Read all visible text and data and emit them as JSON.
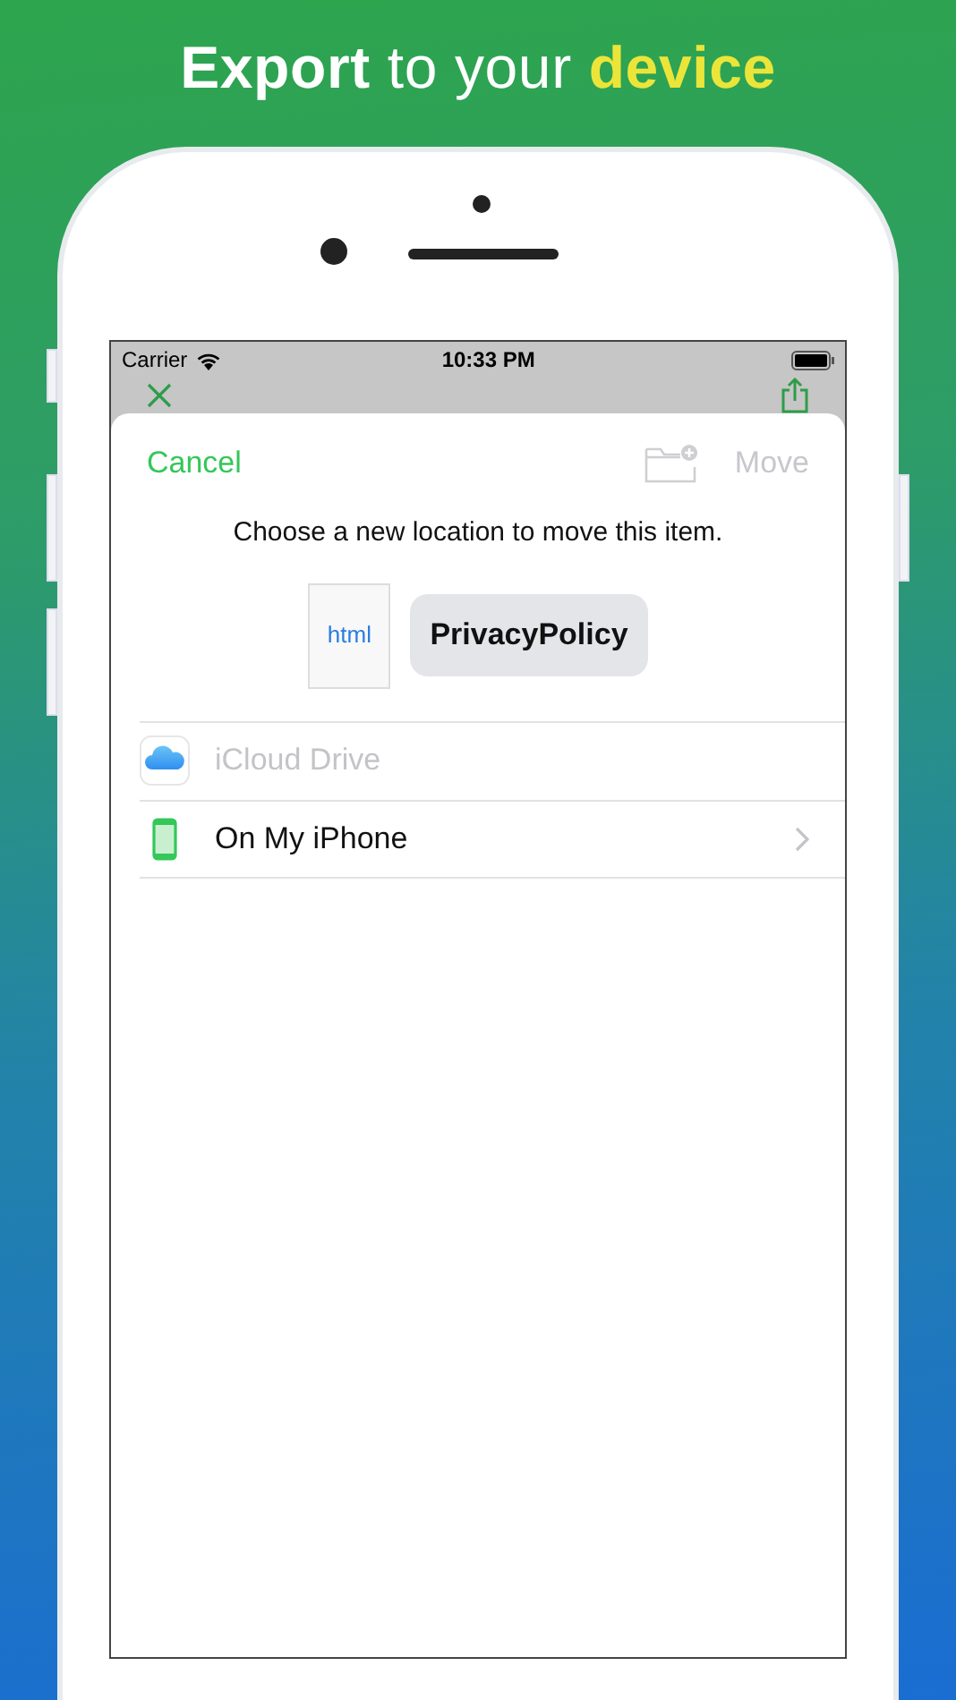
{
  "headline": {
    "parts": [
      {
        "text": "Export",
        "kind": "strong"
      },
      {
        "text": "to your",
        "kind": "plain"
      },
      {
        "text": "device",
        "kind": "accent"
      }
    ]
  },
  "status_bar": {
    "carrier": "Carrier",
    "time": "10:33 PM"
  },
  "sheet": {
    "cancel": {
      "label": "Cancel",
      "disabled": false
    },
    "new_folder": {
      "disabled": true
    },
    "move": {
      "label": "Move",
      "disabled": true
    },
    "instruction": "Choose a new location to move this item.",
    "file": {
      "type": "html",
      "name": "PrivacyPolicy"
    },
    "locations": [
      {
        "label": "iCloud Drive",
        "kind": "cloud",
        "disabled": true
      },
      {
        "label": "On My iPhone",
        "kind": "phone",
        "disabled": false
      }
    ]
  }
}
